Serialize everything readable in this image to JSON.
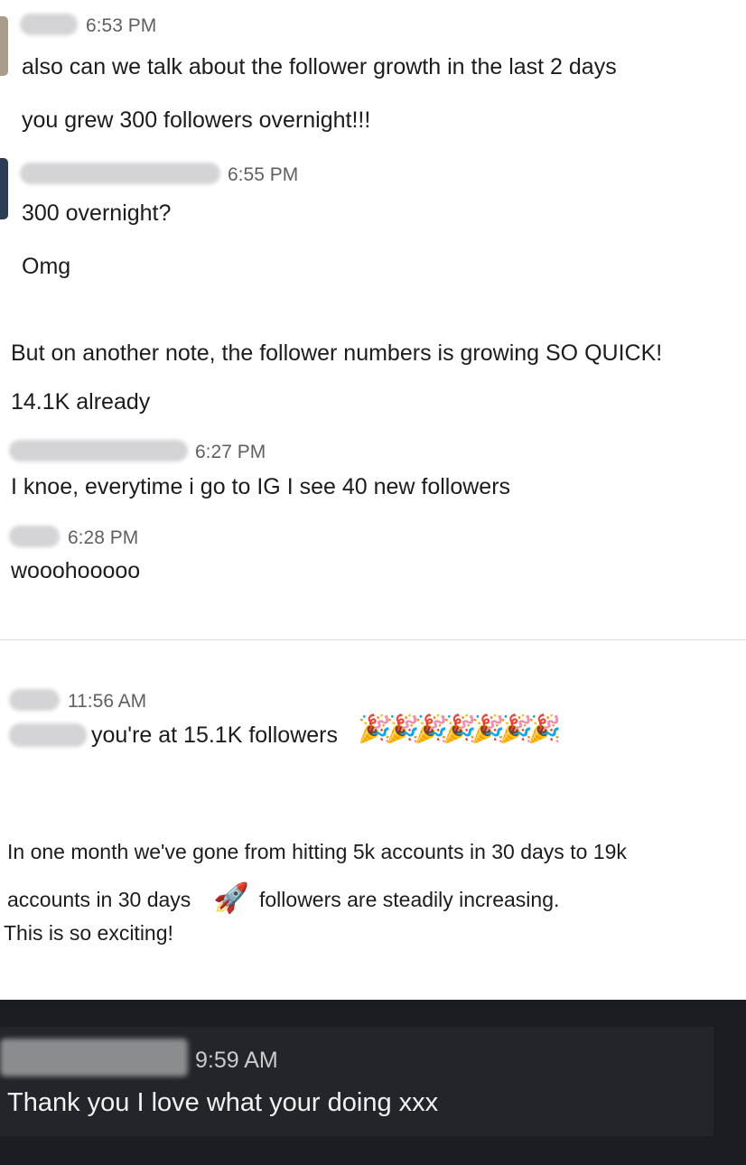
{
  "block1": {
    "time": "6:53 PM",
    "lines": [
      "also can we talk about the follower growth in the last 2 days",
      "you grew 300 followers overnight!!!"
    ]
  },
  "block2": {
    "time": "6:55 PM",
    "lines": [
      "300 overnight?",
      "Omg"
    ]
  },
  "block3": {
    "lines": [
      "But on another note, the follower numbers is growing SO QUICK!",
      "14.1K already"
    ]
  },
  "block4": {
    "time": "6:27 PM",
    "lines": [
      "I knoe, everytime i go to IG I see 40 new followers"
    ]
  },
  "block5": {
    "time": "6:28 PM",
    "lines": [
      "wooohooooo"
    ]
  },
  "block6": {
    "time": "11:56 AM",
    "text": "you're at 15.1K followers",
    "emoji": "🎉",
    "emoji_count": 7
  },
  "block7": {
    "lines": [
      "In one month we've gone from hitting 5k accounts in 30 days to 19k",
      "accounts in 30 days",
      "followers are steadily increasing.",
      "This is so exciting!"
    ],
    "emoji": "🚀"
  },
  "block8": {
    "time": "9:59 AM",
    "lines": [
      "Thank you I love what your doing xxx"
    ]
  },
  "colors": {
    "text": "#1d1c1d",
    "timestamp": "#616061",
    "dark_bg": "#1a1d21",
    "dark_text": "#f2f2f2"
  }
}
